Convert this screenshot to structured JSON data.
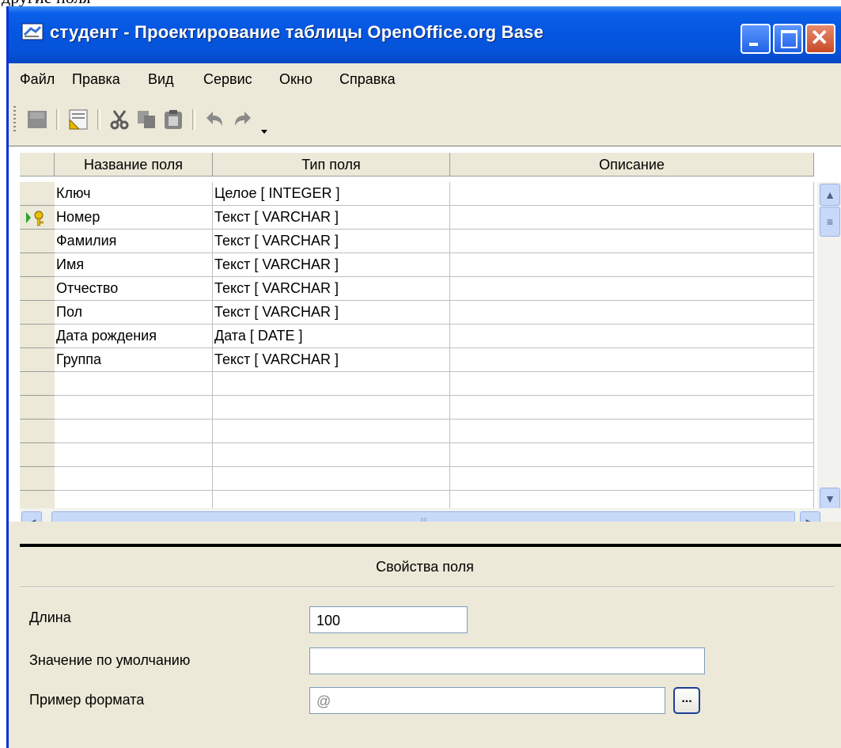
{
  "cropped_text": "другие поля",
  "window": {
    "title": "студент - Проектирование таблицы OpenOffice.org Base",
    "buttons": {
      "minimize": "minimize",
      "maximize": "maximize",
      "close": "✕"
    }
  },
  "menu": [
    "Файл",
    "Правка",
    "Вид",
    "Сервис",
    "Окно",
    "Справка"
  ],
  "toolbar": [
    "save-icon",
    "design-icon",
    "cut-icon",
    "copy-icon",
    "paste-icon",
    "undo-icon",
    "redo-icon",
    "dropdown-arrow-icon"
  ],
  "table": {
    "columns": [
      "Название поля",
      "Тип поля",
      "Описание"
    ],
    "rows": [
      {
        "name": "Ключ",
        "type": "Целое [ INTEGER ]",
        "description": "",
        "marker": ""
      },
      {
        "name": "Номер",
        "type": "Текст [ VARCHAR ]",
        "description": "",
        "marker": "primary-key"
      },
      {
        "name": "Фамилия",
        "type": "Текст [ VARCHAR ]",
        "description": "",
        "marker": ""
      },
      {
        "name": "Имя",
        "type": "Текст [ VARCHAR ]",
        "description": "",
        "marker": ""
      },
      {
        "name": "Отчество",
        "type": "Текст [ VARCHAR ]",
        "description": "",
        "marker": ""
      },
      {
        "name": "Пол",
        "type": "Текст [ VARCHAR ]",
        "description": "",
        "marker": ""
      },
      {
        "name": "Дата рождения",
        "type": "Дата [ DATE ]",
        "description": "",
        "marker": ""
      },
      {
        "name": "Группа",
        "type": "Текст [ VARCHAR ]",
        "description": "",
        "marker": ""
      },
      {
        "name": "",
        "type": "",
        "description": "",
        "marker": ""
      },
      {
        "name": "",
        "type": "",
        "description": "",
        "marker": ""
      },
      {
        "name": "",
        "type": "",
        "description": "",
        "marker": ""
      },
      {
        "name": "",
        "type": "",
        "description": "",
        "marker": ""
      },
      {
        "name": "",
        "type": "",
        "description": "",
        "marker": ""
      },
      {
        "name": "",
        "type": "",
        "description": "",
        "marker": ""
      }
    ]
  },
  "properties": {
    "title": "Свойства поля",
    "length": {
      "label": "Длина",
      "value": "100"
    },
    "default_value": {
      "label": "Значение по умолчанию",
      "value": ""
    },
    "format_example": {
      "label": "Пример формата",
      "value": "@",
      "button": "..."
    }
  },
  "colors": {
    "titlebar": "#0556e0",
    "window_bg": "#ece9d8",
    "key_icon": "#e8c000"
  }
}
